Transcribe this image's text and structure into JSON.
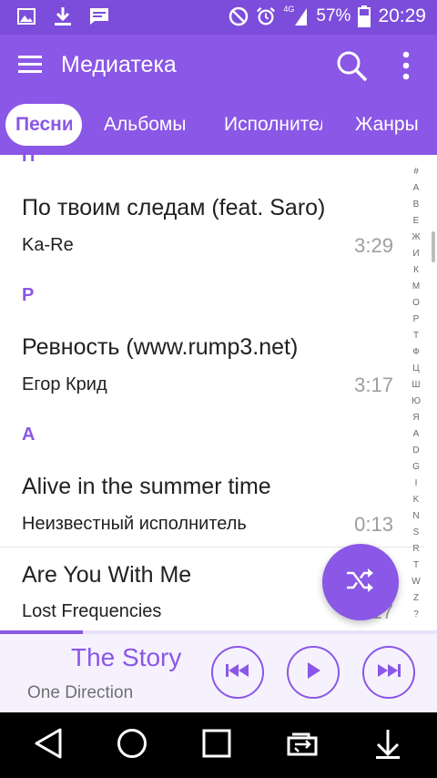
{
  "status_bar": {
    "battery_percent": "57%",
    "time": "20:29",
    "network": "4G",
    "icons": [
      "gallery-icon",
      "download-icon",
      "message-icon",
      "do-not-disturb-icon",
      "alarm-icon",
      "signal-icon",
      "battery-icon"
    ]
  },
  "app_bar": {
    "title": "Медиатека"
  },
  "tabs": [
    {
      "label": "Песни",
      "active": true
    },
    {
      "label": "Альбомы",
      "active": false
    },
    {
      "label": "Исполнители",
      "active": false
    },
    {
      "label": "Жанры",
      "active": false
    }
  ],
  "list": {
    "partial_section_letter": "П",
    "items": [
      {
        "title": "По твоим следам (feat. Saro)",
        "artist": "Ka-Re",
        "duration": "3:29"
      },
      {
        "section": "Р"
      },
      {
        "title": "Ревность (www.rump3.net)",
        "artist": "Егор Крид",
        "duration": "3:17"
      },
      {
        "section": "A"
      },
      {
        "title": "Alive in the summer time",
        "artist": "Неизвестный исполнитель",
        "duration": "0:13"
      },
      {
        "title": "Are You With Me",
        "artist": "Lost Frequencies",
        "duration": "2:17"
      }
    ]
  },
  "alphabet_index": [
    "#",
    "А",
    "В",
    "Е",
    "Ж",
    "И",
    "К",
    "М",
    "О",
    "Р",
    "Т",
    "Ф",
    "Ц",
    "Ш",
    "Ю",
    "Я",
    "A",
    "D",
    "G",
    "I",
    "K",
    "N",
    "S",
    "R",
    "T",
    "W",
    "Z",
    "?"
  ],
  "player": {
    "title": "The Story",
    "artist": "One Direction",
    "progress": 0.19
  },
  "colors": {
    "status_bar": "#7c4ddb",
    "accent": "#8a57e6",
    "text_primary": "#212121",
    "text_secondary": "#9e9e9e",
    "player_bg": "#f6f2fd"
  }
}
